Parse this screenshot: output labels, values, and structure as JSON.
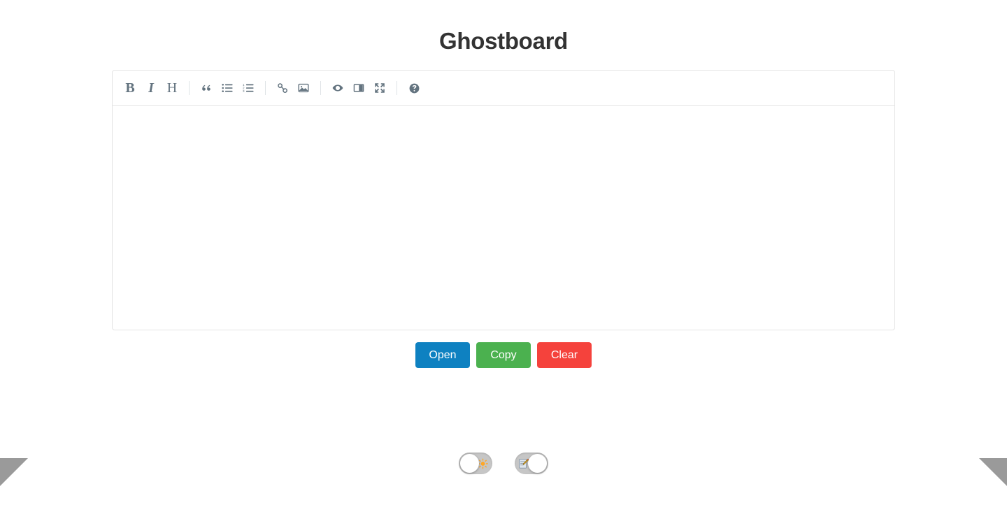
{
  "app": {
    "title": "Ghostboard",
    "background_color": "#ffffff"
  },
  "editor": {
    "content": "",
    "placeholder": "",
    "border_color": "#e4e4e4",
    "toolbar": {
      "icon_color": "#63737f",
      "groups": [
        {
          "items": [
            {
              "name": "bold",
              "label": "B",
              "kind": "letter",
              "style": "bold",
              "title": "Bold"
            },
            {
              "name": "italic",
              "label": "I",
              "kind": "letter",
              "style": "italic",
              "title": "Italic"
            },
            {
              "name": "heading",
              "label": "H",
              "kind": "letter",
              "style": "head",
              "title": "Heading"
            }
          ]
        },
        {
          "items": [
            {
              "name": "quote-icon",
              "label": "“",
              "kind": "icon",
              "title": "Quote"
            },
            {
              "name": "unordered-list-icon",
              "label": "",
              "kind": "icon",
              "title": "Generic List"
            },
            {
              "name": "ordered-list-icon",
              "label": "",
              "kind": "icon",
              "title": "Numbered List"
            }
          ]
        },
        {
          "items": [
            {
              "name": "link-icon",
              "label": "",
              "kind": "icon",
              "title": "Create Link"
            },
            {
              "name": "image-icon",
              "label": "",
              "kind": "icon",
              "title": "Insert Image"
            }
          ]
        },
        {
          "items": [
            {
              "name": "preview-icon",
              "label": "",
              "kind": "icon",
              "title": "Toggle Preview"
            },
            {
              "name": "side-by-side-icon",
              "label": "",
              "kind": "icon",
              "title": "Toggle Side by Side"
            },
            {
              "name": "fullscreen-icon",
              "label": "",
              "kind": "icon",
              "title": "Toggle Fullscreen"
            }
          ]
        },
        {
          "items": [
            {
              "name": "help-icon",
              "label": "",
              "kind": "icon",
              "title": "Markdown Guide"
            }
          ]
        }
      ]
    }
  },
  "actions": {
    "buttons": [
      {
        "name": "open-button",
        "label": "Open",
        "color": "#0e81c1"
      },
      {
        "name": "copy-button",
        "label": "Copy",
        "color": "#4bb14f"
      },
      {
        "name": "clear-button",
        "label": "Clear",
        "color": "#f5423c"
      }
    ]
  },
  "toggles": [
    {
      "name": "theme-toggle",
      "icon": "sun-icon",
      "icon_glyph": "☀",
      "icon_side": "right",
      "knob_side": "left",
      "state": "off",
      "track_color": "#c6c6c6"
    },
    {
      "name": "edit-mode-toggle",
      "icon": "memo-icon",
      "icon_glyph": "📝",
      "icon_side": "left",
      "knob_side": "right",
      "state": "on",
      "track_color": "#c6c6c6"
    }
  ],
  "decorations": {
    "corner_triangle_color": "#9a9a9a",
    "left_triangle": "bottom-left-corner-triangle",
    "right_triangle": "bottom-right-corner-triangle"
  }
}
